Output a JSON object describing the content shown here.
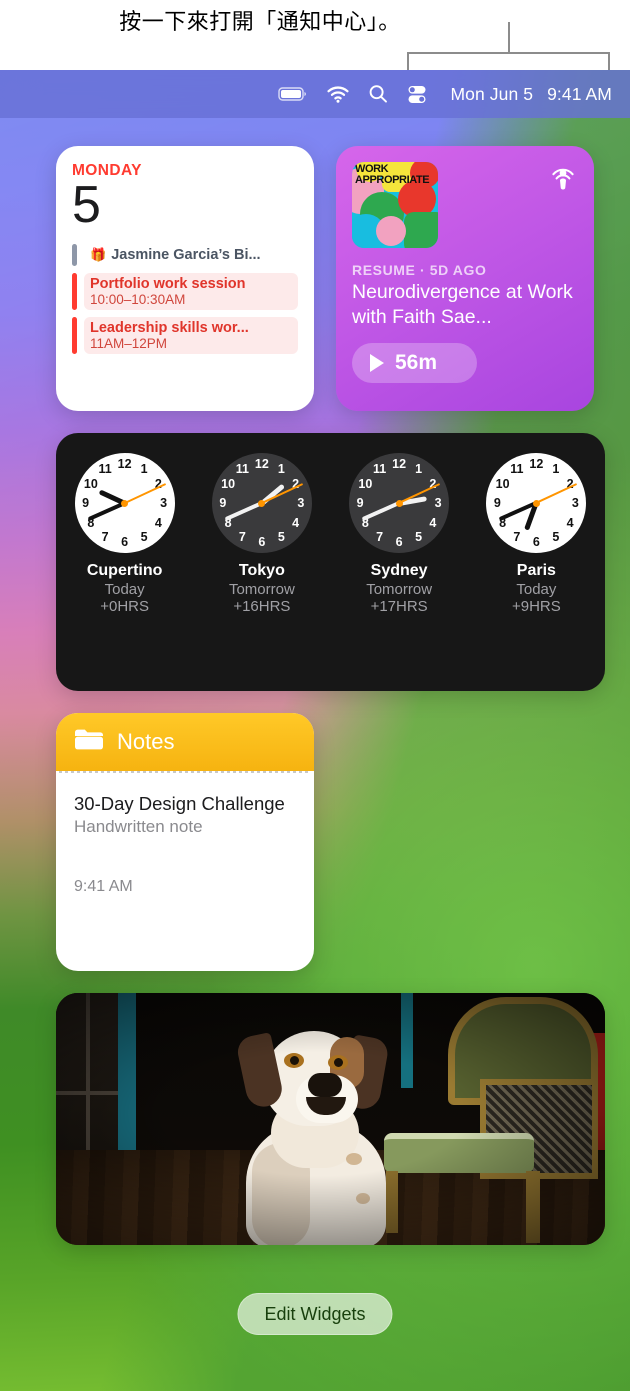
{
  "annotation": {
    "text": "按一下來打開「通知中心」。"
  },
  "menubar": {
    "icons": [
      "battery-icon",
      "wifi-icon",
      "search-icon",
      "control-center-icon"
    ],
    "date": "Mon Jun 5",
    "time": "9:41 AM"
  },
  "widgets": {
    "calendar": {
      "weekday": "MONDAY",
      "day": "5",
      "events": [
        {
          "kind": "birthday",
          "icon": "gift-icon",
          "title": "Jasmine Garcia’s Bi...",
          "time": ""
        },
        {
          "kind": "event",
          "title": "Portfolio work session",
          "time": "10:00–10:30AM"
        },
        {
          "kind": "event",
          "title": "Leadership skills wor...",
          "time": "11AM–12PM"
        }
      ]
    },
    "podcast": {
      "app_icon": "podcasts-icon",
      "artwork_label": "WORK APPROPRIATE",
      "meta": "RESUME · 5D AGO",
      "title": "Neurodivergence at Work with Faith Sae...",
      "duration": "56m",
      "play_icon": "play-icon"
    },
    "world_clock": [
      {
        "city": "Cupertino",
        "when": "Today",
        "offset": "+0HRS",
        "theme": "light",
        "hour_deg": 295,
        "minute_deg": 246,
        "second_deg": 65
      },
      {
        "city": "Tokyo",
        "when": "Tomorrow",
        "offset": "+16HRS",
        "theme": "dark",
        "hour_deg": 50,
        "minute_deg": 246,
        "second_deg": 65
      },
      {
        "city": "Sydney",
        "when": "Tomorrow",
        "offset": "+17HRS",
        "theme": "dark",
        "hour_deg": 80,
        "minute_deg": 246,
        "second_deg": 65
      },
      {
        "city": "Paris",
        "when": "Today",
        "offset": "+9HRS",
        "theme": "light",
        "hour_deg": 200,
        "minute_deg": 246,
        "second_deg": 65
      }
    ],
    "clock_numerals": [
      "12",
      "1",
      "2",
      "3",
      "4",
      "5",
      "6",
      "7",
      "8",
      "9",
      "10",
      "11"
    ],
    "notes": {
      "folder_icon": "folder-icon",
      "header_title": "Notes",
      "note_title": "30-Day Design Challenge",
      "note_subtitle": "Handwritten note",
      "note_time": "9:41 AM"
    },
    "photo": {
      "description": "Photo of a white and brown dog sitting on a wooden floor in a dark room beside a green and gold antique chair"
    }
  },
  "edit_widgets_button": {
    "label": "Edit Widgets"
  },
  "colors": {
    "menubar": "#6870d6",
    "calendar_accent": "#ff3b30",
    "podcast_purple": "#c158e6",
    "notes_yellow": "#f6b310",
    "clock_second_hand": "#ff9500"
  }
}
